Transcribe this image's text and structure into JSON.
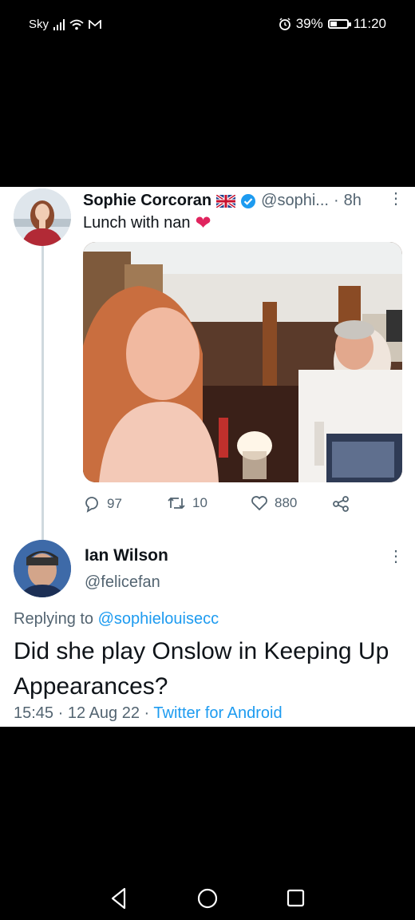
{
  "status_bar": {
    "carrier": "Sky",
    "battery": "39%",
    "battery_level": 0.39,
    "time": "11:20"
  },
  "tweet": {
    "author_name": "Sophie Corcoran",
    "handle": "@sophi...",
    "separator": "·",
    "time_ago": "8h",
    "text": "Lunch with nan",
    "heart_emoji": "❤",
    "replies": "97",
    "retweets": "10",
    "likes": "880"
  },
  "reply": {
    "author_name": "Ian Wilson",
    "handle": "@felicefan",
    "replying_prefix": "Replying to",
    "replying_to": "@sophielouisecc",
    "text": "Did she play Onslow in Keeping Up Appearances?",
    "time": "15:45",
    "separator": "·",
    "date": "12 Aug 22",
    "source": "Twitter for Android"
  },
  "icons": [
    "signal-icon",
    "wifi-icon",
    "gmail-icon",
    "alarm-icon",
    "battery-icon",
    "uk-flag-icon",
    "verified-icon",
    "more-icon",
    "reply-icon",
    "retweet-icon",
    "like-icon",
    "share-icon",
    "back-icon",
    "home-icon",
    "recents-icon"
  ],
  "colors": {
    "accent": "#1d9bf0",
    "heart": "#e0245e",
    "muted": "#536471",
    "text": "#0f1419"
  }
}
